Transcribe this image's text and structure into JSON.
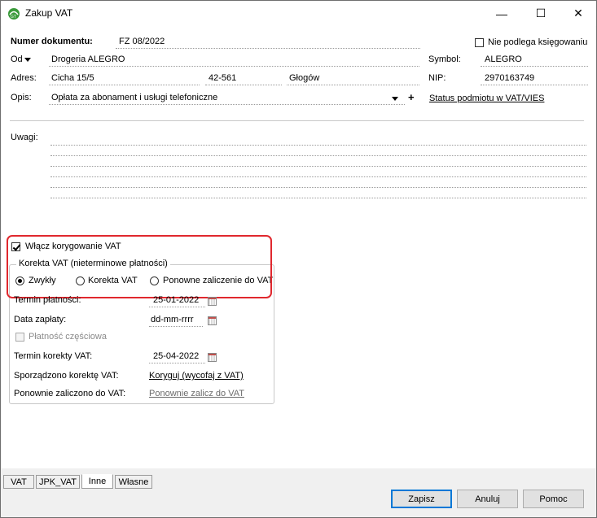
{
  "window": {
    "title": "Zakup VAT",
    "app_icon": "app-logo-icon",
    "minimize": "—",
    "maximize": "☐",
    "close": "✕"
  },
  "header": {
    "doc_number_label": "Numer dokumentu:",
    "doc_number": "FZ 08/2022",
    "not_accounting_label": "Nie podlega księgowaniu",
    "od_label": "Od",
    "od_value": "Drogeria ALEGRO",
    "symbol_label": "Symbol:",
    "symbol_value": "ALEGRO",
    "adres_label": "Adres:",
    "street": "Cicha  15/5",
    "postal": "42-561",
    "city": "Głogów",
    "nip_label": "NIP:",
    "nip_value": "2970163749",
    "opis_label": "Opis:",
    "opis_value": "Opłata za abonament i usługi telefoniczne",
    "plus": "+",
    "status_link": "Status podmiotu w VAT/VIES"
  },
  "uwagi_label": "Uwagi:",
  "vat_correction": {
    "enable_label": "Włącz korygowanie VAT",
    "group_title": "Korekta VAT (nieterminowe płatności)",
    "radios": [
      "Zwykły",
      "Korekta VAT",
      "Ponowne zaliczenie do VAT"
    ],
    "selected_radio": "Zwykły",
    "termin_platnosci_label": "Termin płatności:",
    "termin_platnosci_value": "25-01-2022",
    "data_zaplaty_label": "Data zapłaty:",
    "data_zaplaty_value": "dd-mm-rrrr",
    "platnosc_czesciowa_label": "Płatność częściowa",
    "termin_korekty_label": "Termin korekty VAT:",
    "termin_korekty_value": "25-04-2022",
    "sporzadzono_label": "Sporządzono korektę VAT:",
    "sporzadzono_link": "Koryguj (wycofaj z VAT)",
    "ponownie_label": "Ponownie zaliczono do VAT:",
    "ponownie_link": "Ponownie zalicz do VAT"
  },
  "tabs": [
    "VAT",
    "JPK_VAT",
    "Inne",
    "Własne"
  ],
  "active_tab": "Inne",
  "buttons": {
    "save": "Zapisz",
    "cancel": "Anuluj",
    "help": "Pomoc"
  },
  "colors": {
    "highlight": "#e0282e",
    "accent": "#0078d7"
  }
}
